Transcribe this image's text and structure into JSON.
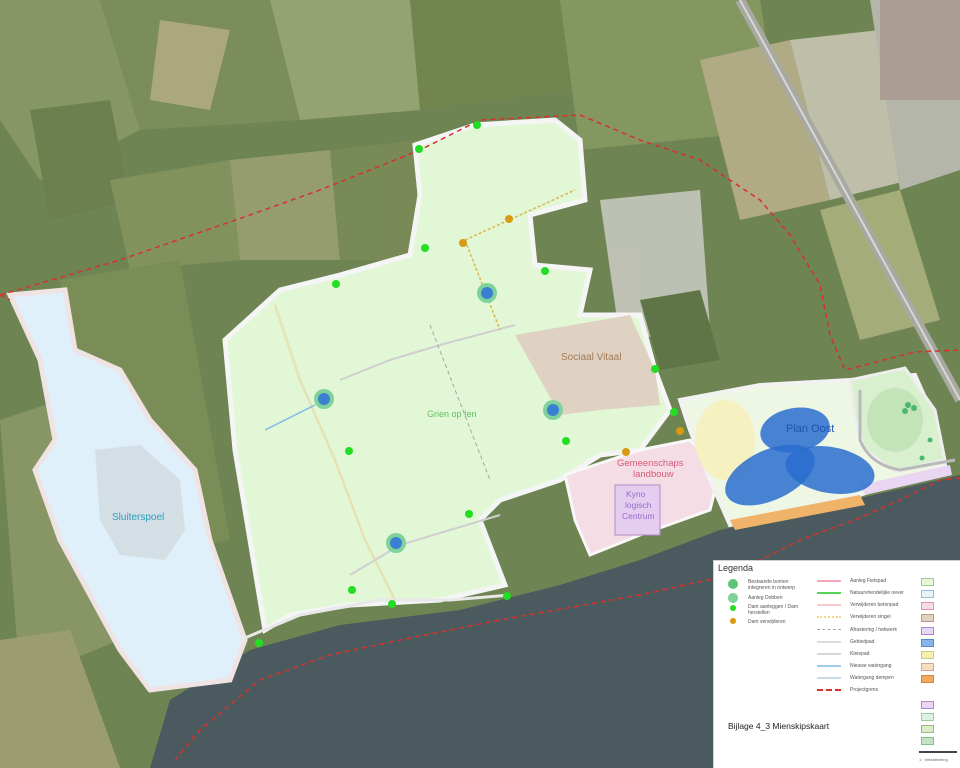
{
  "map": {
    "labels": {
      "sluiterspoel": "Sluiterspoel",
      "grien": "Grien op Ien",
      "sociaal": "Sociaal Vitaal",
      "gemeenschap_1": "Gemeenschaps",
      "gemeenschap_2": "landbouw",
      "kyno_1": "Kyno",
      "kyno_2": "logisch",
      "kyno_3": "Centrum",
      "plan_oost": "Plan Oost"
    },
    "colors": {
      "water": "#4a5a5e",
      "farmland": "#6f8453",
      "green_zone": "#e2f7d6",
      "blue_zone": "#dff0fb",
      "social_zone": "#e0d2c3",
      "pink_zone": "#f4dde4",
      "plan_blue": "#2a6dcf",
      "boundary": "#d9302a",
      "point_green": "#22dd22",
      "point_orange": "#d79a10"
    }
  },
  "legend": {
    "title": "Legenda",
    "left_items": [
      {
        "label": "Bestaande bomen integreren in ontwerp",
        "icon": "tree-cluster-icon"
      },
      {
        "label": "Aanleg Dobben",
        "icon": "pond-icon"
      },
      {
        "label": "Dam aanleggen / Dam herstellen",
        "icon": "green-dot-icon"
      },
      {
        "label": "Dam verwijderen",
        "icon": "orange-dot-icon"
      }
    ],
    "middle_items": [
      {
        "label": "Aanleg Fietspad",
        "color": "#f2a6b6"
      },
      {
        "label": "Natuurvriendelijke oever",
        "color": "#56d456"
      },
      {
        "label": "Verwijderen betonpad",
        "color": "#f7c9c9"
      },
      {
        "label": "Verwijderen singel",
        "color": "#f0d78a"
      },
      {
        "label": "Afrastering / hekwerk",
        "color": "#a8a8a8"
      },
      {
        "label": "Gebiedpad",
        "color": "#dddddd"
      },
      {
        "label": "Kleiepad",
        "color": "#d6d6d6"
      },
      {
        "label": "Nieuwe watergang",
        "color": "#9ccbea"
      },
      {
        "label": "Watergang dempen",
        "color": "#c8dce8"
      },
      {
        "label": "Projectgrens",
        "color": "#d9302a"
      }
    ],
    "swatches": [
      "#e5f7d5",
      "#e6f3fb",
      "#f7dde3",
      "#e0d1c2",
      "#e7d8f0",
      "#8ab4e8",
      "#f6efb0",
      "#f6dfc0",
      "#f2a95b",
      "#dcecc8",
      "#e8d6f2",
      "#dff1e6",
      "#c6e4c2"
    ],
    "bijlage": "Bijlage 4_3 Mienskipskaart",
    "scale_text": "1 : Veldafmeting"
  }
}
